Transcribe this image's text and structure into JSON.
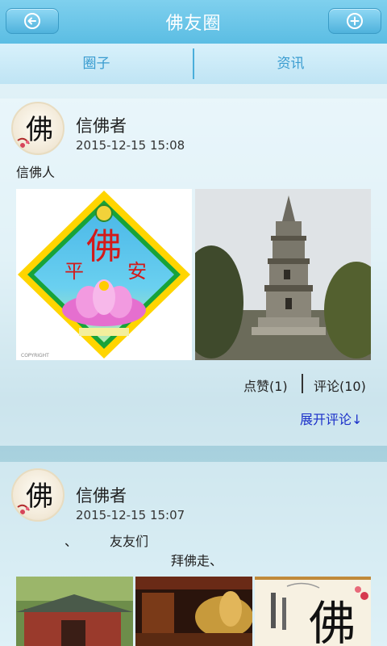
{
  "header": {
    "title": "佛友圈"
  },
  "tabs": [
    {
      "label": "圈子"
    },
    {
      "label": "资讯"
    }
  ],
  "posts": [
    {
      "username": "信佛者",
      "time": "2015-12-15 15:08",
      "text": "信佛人",
      "images": [
        {
          "caption_left": "平",
          "caption_center": "佛",
          "caption_right": "安"
        },
        {
          "kind": "pagoda-photo"
        }
      ],
      "likes_label": "点赞(1)",
      "comments_label": "评论(10)",
      "expand_label": "展开评论↓"
    },
    {
      "username": "信佛者",
      "time": "2015-12-15 15:07",
      "text_line1_a": "、",
      "text_line1_b": "友友们",
      "text_line2": "拜佛走、",
      "images": [
        {
          "kind": "temple-photo"
        },
        {
          "kind": "reclining-buddha-photo"
        },
        {
          "kind": "calligraphy-photo",
          "character": "佛"
        }
      ]
    }
  ],
  "avatar_character": "佛",
  "colors": {
    "accent": "#5bbde3",
    "tab_text": "#3a9cd0",
    "link": "#1a2fc9"
  }
}
